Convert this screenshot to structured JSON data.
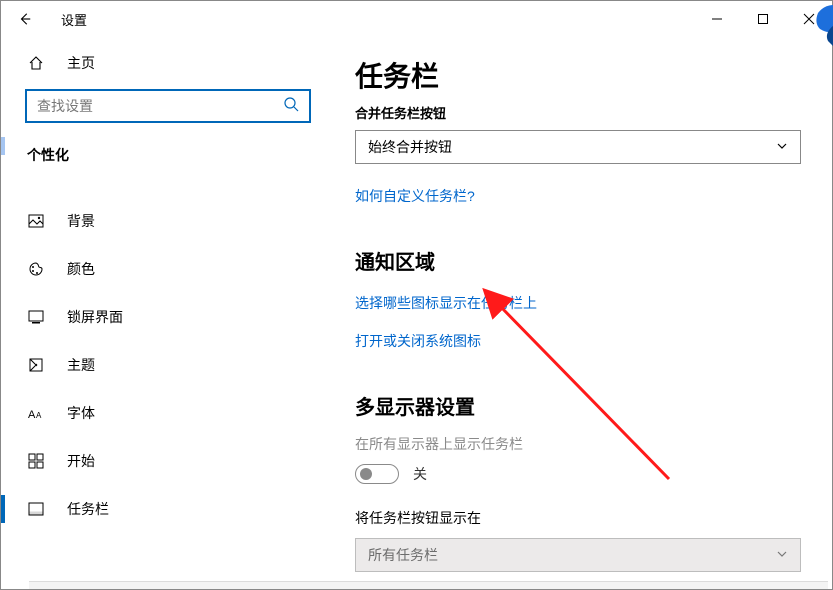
{
  "window": {
    "title": "设置"
  },
  "sidebar": {
    "home_label": "主页",
    "search_placeholder": "查找设置",
    "section_label": "个性化",
    "items": [
      {
        "label": "背景"
      },
      {
        "label": "颜色"
      },
      {
        "label": "锁屏界面"
      },
      {
        "label": "主题"
      },
      {
        "label": "字体"
      },
      {
        "label": "开始"
      },
      {
        "label": "任务栏"
      }
    ]
  },
  "main": {
    "heading": "任务栏",
    "combine_label": "合并任务栏按钮",
    "combine_value": "始终合并按钮",
    "customize_link": "如何自定义任务栏?",
    "notify_heading": "通知区域",
    "select_icons_link": "选择哪些图标显示在任务栏上",
    "system_icons_link": "打开或关闭系统图标",
    "multi_heading": "多显示器设置",
    "multi_show_label": "在所有显示器上显示任务栏",
    "multi_toggle_state": "关",
    "show_buttons_label": "将任务栏按钮显示在",
    "show_buttons_value": "所有任务栏"
  }
}
